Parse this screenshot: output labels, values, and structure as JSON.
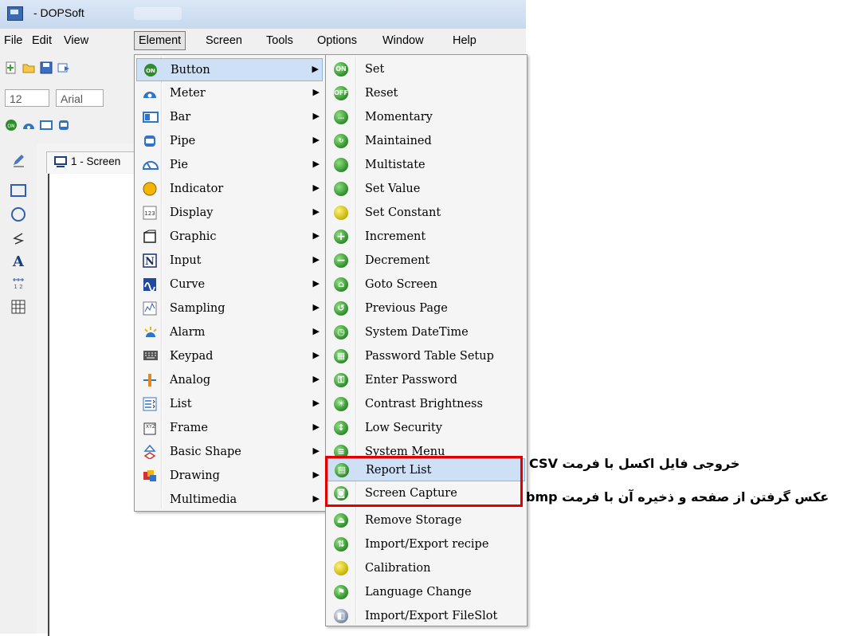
{
  "window": {
    "title": "- DOPSoft"
  },
  "menubar": [
    "File",
    "Edit",
    "View",
    "Element",
    "Screen",
    "Tools",
    "Options",
    "Window",
    "Help"
  ],
  "toolbar": {
    "font_size": "12",
    "font_name": "Arial"
  },
  "document_tab": {
    "label": "1 - Screen"
  },
  "element_menu": [
    {
      "label": "Button",
      "icon": "button-icon"
    },
    {
      "label": "Meter",
      "icon": "meter-icon"
    },
    {
      "label": "Bar",
      "icon": "bar-icon"
    },
    {
      "label": "Pipe",
      "icon": "pipe-icon"
    },
    {
      "label": "Pie",
      "icon": "pie-icon"
    },
    {
      "label": "Indicator",
      "icon": "indicator-icon"
    },
    {
      "label": "Display",
      "icon": "display-icon"
    },
    {
      "label": "Graphic",
      "icon": "graphic-icon"
    },
    {
      "label": "Input",
      "icon": "input-icon"
    },
    {
      "label": "Curve",
      "icon": "curve-icon"
    },
    {
      "label": "Sampling",
      "icon": "sampling-icon"
    },
    {
      "label": "Alarm",
      "icon": "alarm-icon"
    },
    {
      "label": "Keypad",
      "icon": "keypad-icon"
    },
    {
      "label": "Analog",
      "icon": "analog-icon"
    },
    {
      "label": "List",
      "icon": "list-icon"
    },
    {
      "label": "Frame",
      "icon": "frame-icon"
    },
    {
      "label": "Basic Shape",
      "icon": "basic-shape-icon"
    },
    {
      "label": "Drawing",
      "icon": "drawing-icon"
    },
    {
      "label": "Multimedia",
      "icon": ""
    }
  ],
  "button_submenu": [
    {
      "label": "Set",
      "badge": "ON"
    },
    {
      "label": "Reset",
      "badge": "OFF"
    },
    {
      "label": "Momentary",
      "badge": "…"
    },
    {
      "label": "Maintained",
      "badge": "↻"
    },
    {
      "label": "Multistate",
      "badge": ""
    },
    {
      "label": "Set Value",
      "badge": ""
    },
    {
      "label": "Set Constant",
      "badge": ""
    },
    {
      "label": "Increment",
      "badge": "+"
    },
    {
      "label": "Decrement",
      "badge": "−"
    },
    {
      "label": "Goto Screen",
      "badge": "⌂"
    },
    {
      "label": "Previous Page",
      "badge": "↺"
    },
    {
      "label": "System DateTime",
      "badge": "◷"
    },
    {
      "label": "Password Table Setup",
      "badge": "▦"
    },
    {
      "label": "Enter Password",
      "badge": "⚿"
    },
    {
      "label": "Contrast Brightness",
      "badge": "☀"
    },
    {
      "label": "Low Security",
      "badge": "↕"
    },
    {
      "label": "System Menu",
      "badge": "≡"
    },
    {
      "label": "Report List",
      "badge": "▤"
    },
    {
      "label": "Screen Capture",
      "badge": "◙"
    },
    {
      "label": "Remove Storage",
      "badge": "⏏"
    },
    {
      "label": "Import/Export recipe",
      "badge": "⇅"
    },
    {
      "label": "Calibration",
      "badge": ""
    },
    {
      "label": "Language Change",
      "badge": "⚑"
    },
    {
      "label": "Import/Export FileSlot",
      "badge": "◧"
    }
  ],
  "annotations": {
    "report_list": "خروجی فایل اکسل با فرمت CSV",
    "screen_capture": "عکس گرفتن از صفحه و ذخیره آن با فرمت bmp"
  },
  "colors": {
    "highlight": "#cde0f5",
    "annotation_box": "#e00000",
    "icon_green": "#2e8d2a"
  }
}
